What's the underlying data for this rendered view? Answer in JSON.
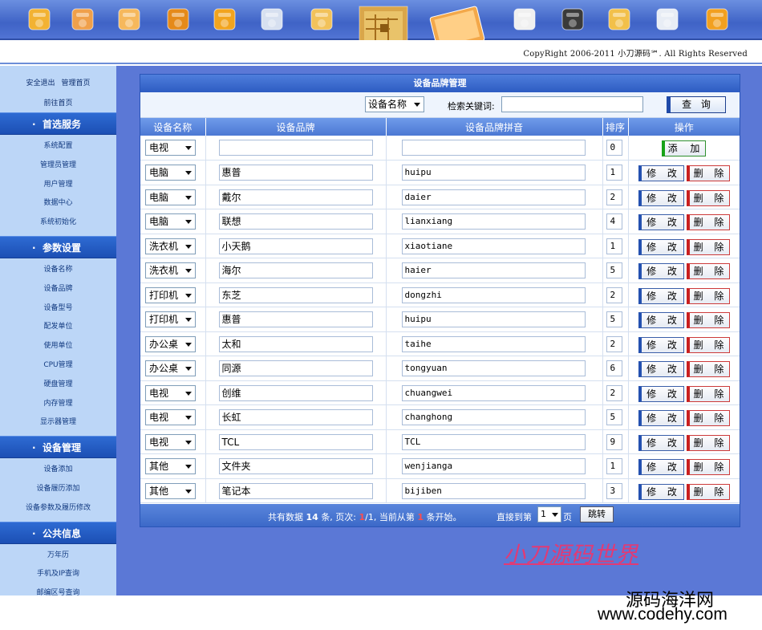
{
  "header": {
    "copyright": "CopyRight 2006-2011 小刀源码℠. All Rights Reserved",
    "icons": [
      "tools-icon",
      "user-icon",
      "users-icon",
      "illustrator-icon",
      "briefcase-icon",
      "memory-chip-icon",
      "hard-drive-icon",
      "circuit-board-icon",
      "monitor-screen-icon",
      "settings-cd-icon",
      "clapperboard-icon",
      "windows-box-icon",
      "calendar-icon",
      "chain-link-icon"
    ]
  },
  "sidebar": {
    "top_links": [
      "安全退出",
      "管理首页"
    ],
    "home_link": "前往首页",
    "sections": [
      {
        "title": "首选服务",
        "items": [
          "系统配置",
          "管理员管理",
          "用户管理",
          "数据中心",
          "系统初始化"
        ]
      },
      {
        "title": "参数设置",
        "items": [
          "设备名称",
          "设备品牌",
          "设备型号",
          "配发单位",
          "使用单位",
          "CPU管理",
          "硬盘管理",
          "内存管理",
          "显示器管理"
        ]
      },
      {
        "title": "设备管理",
        "items": [
          "设备添加",
          "设备履历添加",
          "设备参数及履历修改"
        ]
      },
      {
        "title": "公共信息",
        "items": [
          "万年历",
          "手机及IP查询",
          "邮编区号查询"
        ]
      }
    ]
  },
  "panel": {
    "title": "设备品牌管理",
    "search_field": "设备名称",
    "search_label": "检索关键词:",
    "search_value": "",
    "search_button": "查 询",
    "columns": [
      "设备名称",
      "设备品牌",
      "设备品牌拼音",
      "排序",
      "操作"
    ],
    "add_row": {
      "device": "电视",
      "brand": "",
      "pinyin": "",
      "order": "0",
      "add_label": "添 加"
    },
    "edit_label": "修 改",
    "delete_label": "删 除",
    "rows": [
      {
        "device": "电脑",
        "brand": "惠普",
        "pinyin": "huipu",
        "order": "1"
      },
      {
        "device": "电脑",
        "brand": "戴尔",
        "pinyin": "daier",
        "order": "2"
      },
      {
        "device": "电脑",
        "brand": "联想",
        "pinyin": "lianxiang",
        "order": "4"
      },
      {
        "device": "洗衣机",
        "brand": "小天鹅",
        "pinyin": "xiaotiane",
        "order": "1"
      },
      {
        "device": "洗衣机",
        "brand": "海尔",
        "pinyin": "haier",
        "order": "5"
      },
      {
        "device": "打印机",
        "brand": "东芝",
        "pinyin": "dongzhi",
        "order": "2"
      },
      {
        "device": "打印机",
        "brand": "惠普",
        "pinyin": "huipu",
        "order": "5"
      },
      {
        "device": "办公桌",
        "brand": "太和",
        "pinyin": "taihe",
        "order": "2"
      },
      {
        "device": "办公桌",
        "brand": "同源",
        "pinyin": "tongyuan",
        "order": "6"
      },
      {
        "device": "电视",
        "brand": "创维",
        "pinyin": "chuangwei",
        "order": "2"
      },
      {
        "device": "电视",
        "brand": "长虹",
        "pinyin": "changhong",
        "order": "5"
      },
      {
        "device": "电视",
        "brand": "TCL",
        "pinyin": "TCL",
        "order": "9"
      },
      {
        "device": "其他",
        "brand": "文件夹",
        "pinyin": "wenjianga",
        "order": "1"
      },
      {
        "device": "其他",
        "brand": "笔记本",
        "pinyin": "bijiben",
        "order": "3"
      }
    ],
    "pager": {
      "text_a": "共有数据",
      "total": "14",
      "text_b": "条, 页次:",
      "current": "1",
      "pages": "/1,",
      "text_c": "当前从第",
      "start": "1",
      "text_d": "条开始。",
      "jump_label": "直接到第",
      "page_select": "1",
      "page_unit": "页",
      "jump_button": "跳转"
    }
  },
  "brand_text": "小刀源码世界",
  "watermark": {
    "cn": "源码海洋网",
    "url": "www.codehy.com"
  }
}
